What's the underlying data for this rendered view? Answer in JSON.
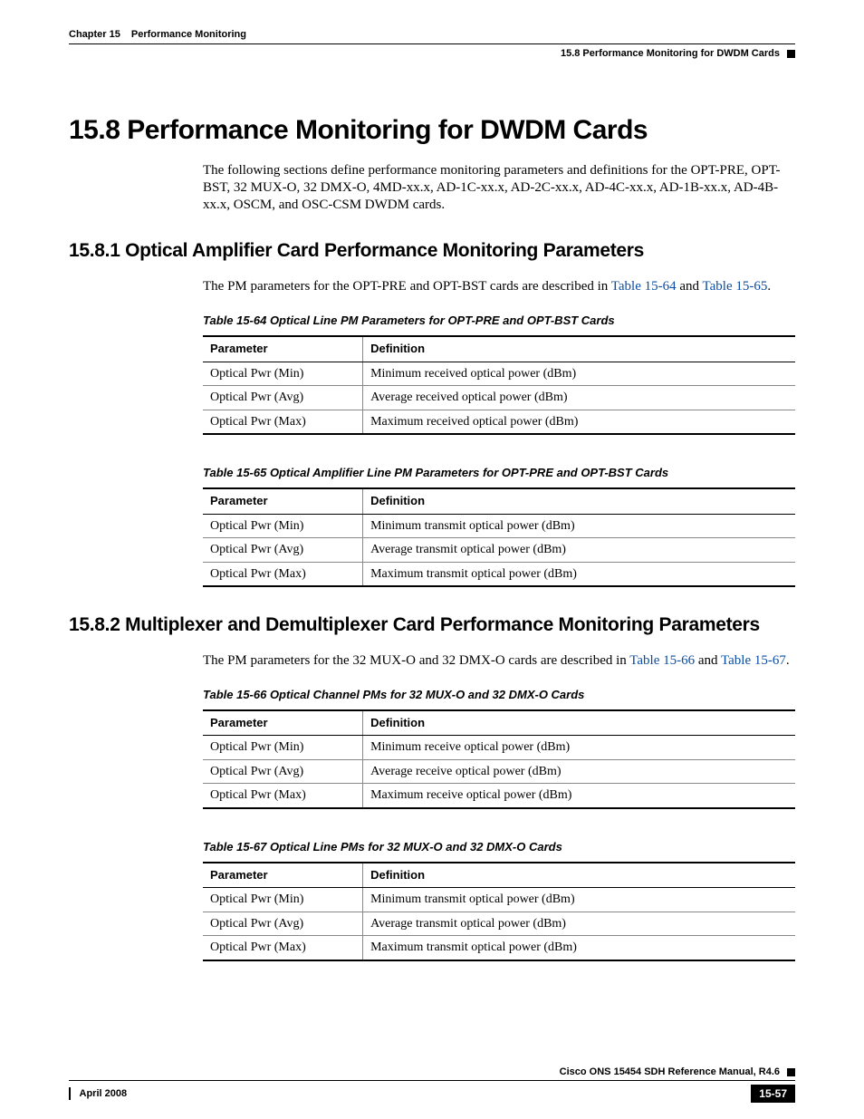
{
  "header": {
    "chapter_label": "Chapter 15",
    "chapter_title": "Performance Monitoring",
    "section_path": "15.8  Performance Monitoring for DWDM Cards"
  },
  "h1": "15.8  Performance Monitoring for DWDM Cards",
  "intro": "The following sections define performance monitoring parameters and definitions for the OPT-PRE, OPT-BST, 32 MUX-O, 32 DMX-O, 4MD-xx.x, AD-1C-xx.x, AD-2C-xx.x, AD-4C-xx.x, AD-1B-xx.x, AD-4B-xx.x, OSCM, and OSC-CSM DWDM cards.",
  "s1": {
    "heading": "15.8.1  Optical Amplifier Card Performance Monitoring Parameters",
    "para_pre": "The PM parameters for the OPT-PRE and OPT-BST cards are described in ",
    "link1": "Table 15-64",
    "mid": " and ",
    "link2": "Table 15-65",
    "post": "."
  },
  "tables": {
    "t64": {
      "caption": "Table 15-64 Optical Line PM Parameters for OPT-PRE and OPT-BST Cards",
      "h1": "Parameter",
      "h2": "Definition",
      "r1c1": "Optical Pwr (Min)",
      "r1c2": "Minimum received optical power (dBm)",
      "r2c1": "Optical Pwr (Avg)",
      "r2c2": "Average received optical power (dBm)",
      "r3c1": "Optical Pwr (Max)",
      "r3c2": "Maximum received optical power (dBm)"
    },
    "t65": {
      "caption": "Table 15-65 Optical Amplifier Line PM Parameters for OPT-PRE and OPT-BST Cards",
      "h1": "Parameter",
      "h2": "Definition",
      "r1c1": "Optical Pwr (Min)",
      "r1c2": "Minimum transmit optical power (dBm)",
      "r2c1": "Optical Pwr (Avg)",
      "r2c2": "Average transmit optical power (dBm)",
      "r3c1": "Optical Pwr (Max)",
      "r3c2": "Maximum transmit optical power (dBm)"
    },
    "t66": {
      "caption": "Table 15-66 Optical Channel PMs for 32 MUX-O and 32 DMX-O Cards",
      "h1": "Parameter",
      "h2": "Definition",
      "r1c1": "Optical Pwr (Min)",
      "r1c2": "Minimum receive optical power (dBm)",
      "r2c1": "Optical Pwr (Avg)",
      "r2c2": "Average receive optical power (dBm)",
      "r3c1": "Optical Pwr (Max)",
      "r3c2": "Maximum receive optical power (dBm)"
    },
    "t67": {
      "caption": "Table 15-67 Optical Line PMs for 32 MUX-O and 32 DMX-O Cards",
      "h1": "Parameter",
      "h2": "Definition",
      "r1c1": "Optical Pwr (Min)",
      "r1c2": "Minimum transmit optical power (dBm)",
      "r2c1": "Optical Pwr (Avg)",
      "r2c2": "Average transmit optical power (dBm)",
      "r3c1": "Optical Pwr (Max)",
      "r3c2": "Maximum transmit optical power (dBm)"
    }
  },
  "s2": {
    "heading": "15.8.2  Multiplexer and Demultiplexer Card Performance Monitoring Parameters",
    "para_pre": "The PM parameters for the 32 MUX-O and 32 DMX-O cards are described in ",
    "link1": "Table 15-66",
    "mid": " and ",
    "link2": "Table 15-67",
    "post": "."
  },
  "footer": {
    "manual": "Cisco ONS 15454 SDH Reference Manual, R4.6",
    "date": "April 2008",
    "page": "15-57"
  }
}
